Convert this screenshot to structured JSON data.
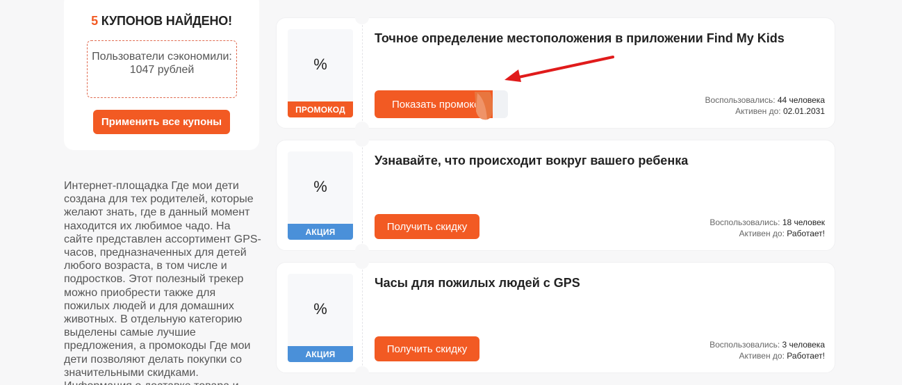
{
  "sidebar": {
    "found_count": "5",
    "found_text": "КУПОНОВ НАЙДЕНО!",
    "saved_text": "Пользователи сэкономили: 1047 рублей",
    "apply_button": "Применить все купоны",
    "description": "Интернет-площадка Где мои дети создана для тех родителей, которые желают знать, где в данный момент находится их любимое чадо. На сайте представлен ассортимент GPS-часов, предназначенных для детей любого возраста, в том числе и подростков. Этот полезный трекер можно приобрести также для пожилых людей и для домашних животных. В отдельную категорию выделены самые лучшие предложения, а промокоды Где мои дети позволяют делать покупки со значительными скидками. Информация о доставке товара и"
  },
  "coupons": [
    {
      "icon": "%",
      "tag": "ПРОМОКОД",
      "title": "Точное определение местоположения в приложении Find My Kids",
      "button": "Показать промокод",
      "used_label": "Воспользовались:",
      "used_value": "44 человека",
      "active_label": "Активен до:",
      "active_value": "02.01.2031"
    },
    {
      "icon": "%",
      "tag": "АКЦИЯ",
      "title": "Узнавайте, что происходит вокруг вашего ребенка",
      "button": "Получить скидку",
      "used_label": "Воспользовались:",
      "used_value": "18 человек",
      "active_label": "Активен до:",
      "active_value": "Работает!"
    },
    {
      "icon": "%",
      "tag": "АКЦИЯ",
      "title": "Часы для пожилых людей с GPS",
      "button": "Получить скидку",
      "used_label": "Воспользовались:",
      "used_value": "3 человека",
      "active_label": "Активен до:",
      "active_value": "Работает!"
    }
  ],
  "colors": {
    "accent": "#f25a23",
    "deal_tag": "#4a90d9",
    "arrow": "#e01b1b"
  }
}
